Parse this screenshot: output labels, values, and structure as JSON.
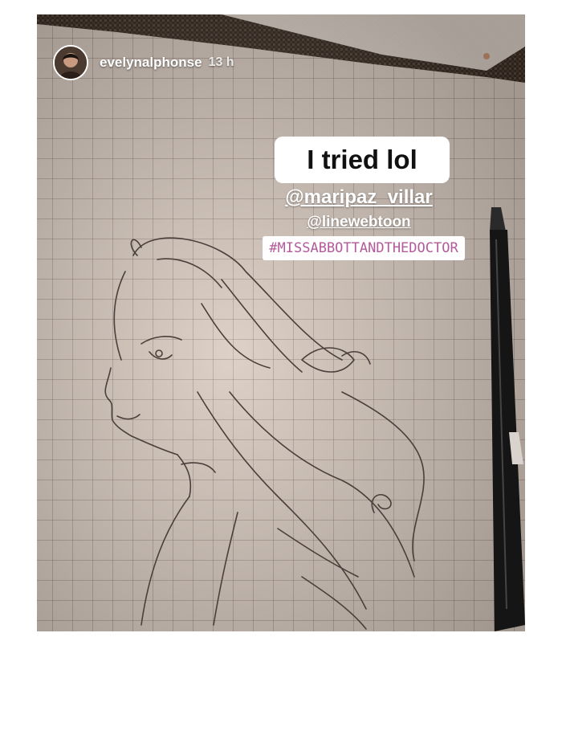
{
  "story": {
    "username": "evelynalphonse",
    "time": "13 h",
    "caption": "I tried lol",
    "mentions": [
      "@maripaz_villar",
      "@linewebtoon"
    ],
    "hashtag": "#MISSABBOTTANDTHEDOCTOR"
  },
  "icons": {
    "avatar": "profile-photo",
    "pen": "pen-photo"
  },
  "colors": {
    "paper": "#d9cbc0",
    "hashtag_text": "#b45a9a",
    "text_light": "#ffffff"
  }
}
